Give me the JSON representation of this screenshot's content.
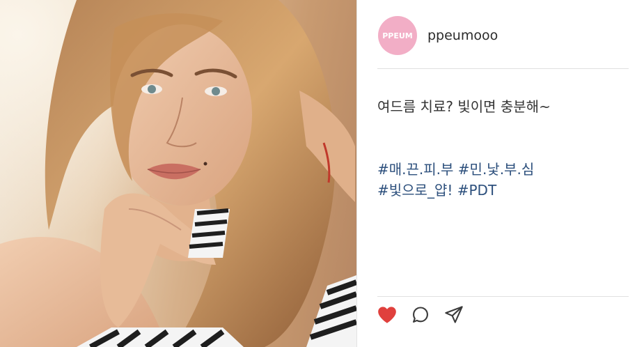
{
  "post": {
    "avatar_text": "PPEUM",
    "username": "ppeumooo",
    "caption": "여드름 치료? 빛이면 충분해~",
    "hashtag_lines": [
      "#매.끈.피.부  #민.낯.부.심",
      "#빛으로_얍!  #PDT"
    ]
  },
  "actions": {
    "like": "heart-icon",
    "comment": "comment-icon",
    "share": "share-icon"
  },
  "colors": {
    "avatar_bg": "#f2aec6",
    "hashtag": "#2c4f7c",
    "like": "#e0403d",
    "icon_stroke": "#3a3a3a"
  }
}
